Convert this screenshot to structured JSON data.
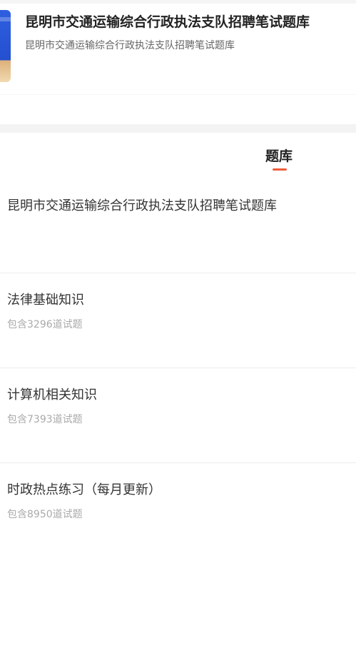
{
  "header": {
    "title": "昆明市交通运输综合行政执法支队招聘笔试题库",
    "subtitle": "昆明市交通运输综合行政执法支队招聘笔试题库"
  },
  "tabs": [
    {
      "label": "题库",
      "active": true
    }
  ],
  "exam_title": "昆明市交通运输综合行政执法支队招聘笔试题库",
  "items": [
    {
      "title": "法律基础知识",
      "count": "包含3296道试题"
    },
    {
      "title": "计算机相关知识",
      "count": "包含7393道试题"
    },
    {
      "title": "时政热点练习（每月更新）",
      "count": "包含8950道试题"
    }
  ],
  "colors": {
    "accent": "#ef5a3b",
    "background": "#ffffff",
    "separator": "#f3f3f3"
  }
}
